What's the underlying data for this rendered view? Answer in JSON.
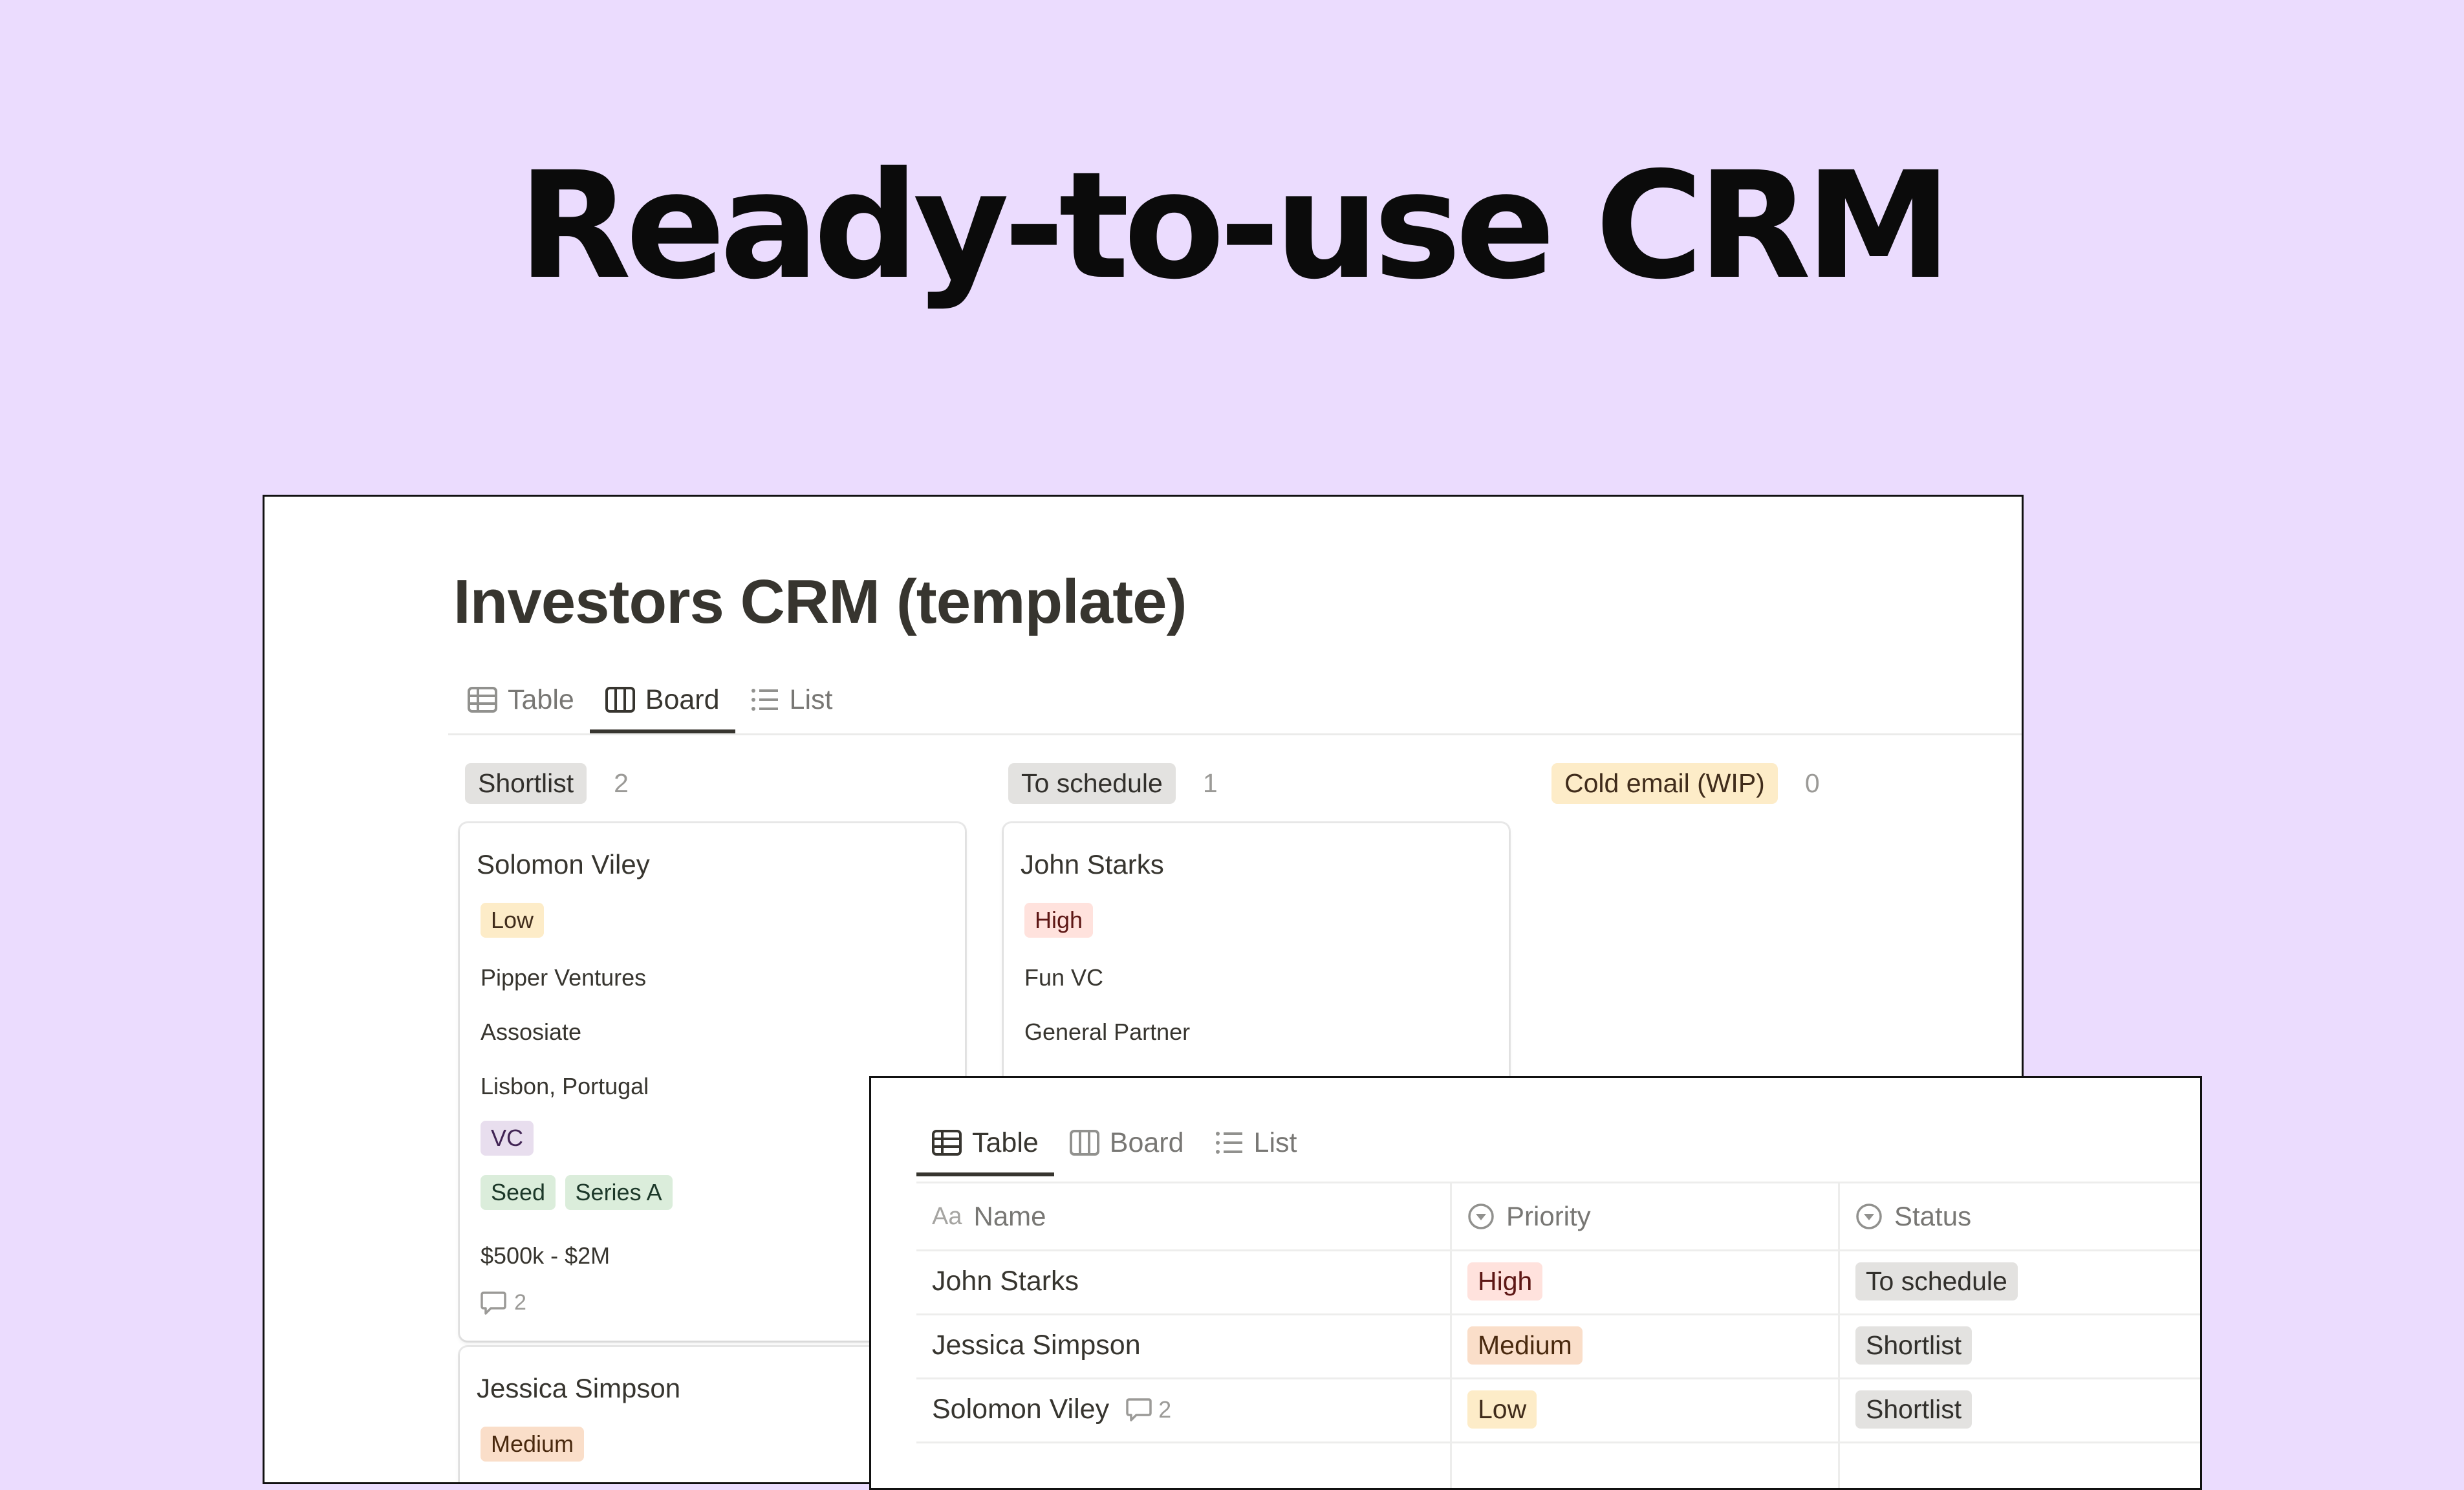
{
  "hero": {
    "title": "Ready-to-use CRM"
  },
  "board_window": {
    "title": "Investors CRM (template)",
    "tabs": [
      {
        "label": "Table",
        "icon": "table-icon",
        "active": false
      },
      {
        "label": "Board",
        "icon": "board-icon",
        "active": true
      },
      {
        "label": "List",
        "icon": "list-icon",
        "active": false
      }
    ],
    "columns": [
      {
        "label": "Shortlist",
        "count": "2"
      },
      {
        "label": "To schedule",
        "count": "1"
      },
      {
        "label": "Cold email (WIP)",
        "count": "0"
      }
    ],
    "cards": {
      "solomon": {
        "name": "Solomon Viley",
        "priority": "Low",
        "company": "Pipper Ventures",
        "role": "Assosiate",
        "location": "Lisbon, Portugal",
        "type": "VC",
        "stages": [
          "Seed",
          "Series A"
        ],
        "check_size": "$500k - $2M",
        "comments": "2"
      },
      "jessica": {
        "name": "Jessica Simpson",
        "priority": "Medium"
      },
      "john": {
        "name": "John Starks",
        "priority": "High",
        "company": "Fun VC",
        "role": "General Partner"
      }
    }
  },
  "table_window": {
    "tabs": [
      {
        "label": "Table",
        "icon": "table-icon",
        "active": true
      },
      {
        "label": "Board",
        "icon": "board-icon",
        "active": false
      },
      {
        "label": "List",
        "icon": "list-icon",
        "active": false
      }
    ],
    "columns": [
      {
        "label": "Name",
        "icon": "Aa"
      },
      {
        "label": "Priority",
        "icon": "select-icon"
      },
      {
        "label": "Status",
        "icon": "select-icon"
      }
    ],
    "rows": [
      {
        "name": "John Starks",
        "priority": "High",
        "status": "To schedule",
        "comments": ""
      },
      {
        "name": "Jessica Simpson",
        "priority": "Medium",
        "status": "Shortlist",
        "comments": ""
      },
      {
        "name": "Solomon Viley",
        "priority": "Low",
        "status": "Shortlist",
        "comments": "2"
      }
    ]
  },
  "colors": {
    "background": "#ebdcfe",
    "tag_low": "#fdecc8",
    "tag_high": "#ffe2dd",
    "tag_medium": "#fadec9",
    "tag_vc": "#e8deee",
    "tag_green": "#dbeddb",
    "tag_status": "#e3e2e0"
  }
}
